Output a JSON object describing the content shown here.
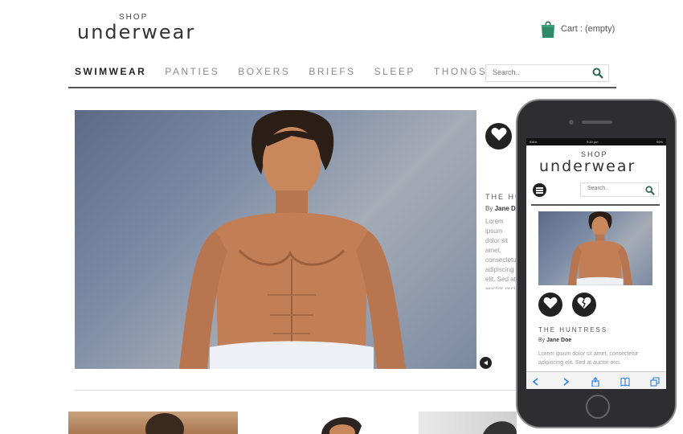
{
  "header": {
    "logo_small": "SHOP",
    "logo_main": "underwear",
    "cart_label": "Cart : (empty)"
  },
  "nav": {
    "items": [
      {
        "label": "SWIMWEAR",
        "active": true
      },
      {
        "label": "PANTIES",
        "active": false
      },
      {
        "label": "BOXERS",
        "active": false
      },
      {
        "label": "BRIEFS",
        "active": false
      },
      {
        "label": "SLEEP",
        "active": false
      },
      {
        "label": "THONGS",
        "active": false
      }
    ],
    "search_placeholder": "Search.."
  },
  "featured": {
    "title": "THE HUNTRESS",
    "by_prefix": "By ",
    "author": "Jane Doe",
    "excerpt": "Lorem ipsum dolor sit amet, consectetur adipiscing elit. Sed at auctor orci, vitae lorem hendrerit, blandit egestas augue. Vestibulum faucibus orci."
  },
  "mobile": {
    "status": {
      "carrier": "IDEA",
      "time": "9:20 pm",
      "battery": "90%"
    },
    "logo_small": "SHOP",
    "logo_main": "underwear",
    "search_placeholder": "Search..",
    "title": "THE HUNTRESS",
    "by_prefix": "By ",
    "author": "Jane Doe",
    "excerpt": "Lorem ipsum dolor sit amet, consectetur adipiscing elit. Sed at auctor orci."
  },
  "colors": {
    "accent_green": "#2f8a6a",
    "nav_active": "#222222",
    "nav_inactive": "#8a8a8a",
    "ios_blue": "#2f7fe0"
  },
  "icons": [
    "shopping-bag-icon",
    "search-icon",
    "heart-icon",
    "broken-heart-icon",
    "arrow-left-icon",
    "menu-icon"
  ]
}
